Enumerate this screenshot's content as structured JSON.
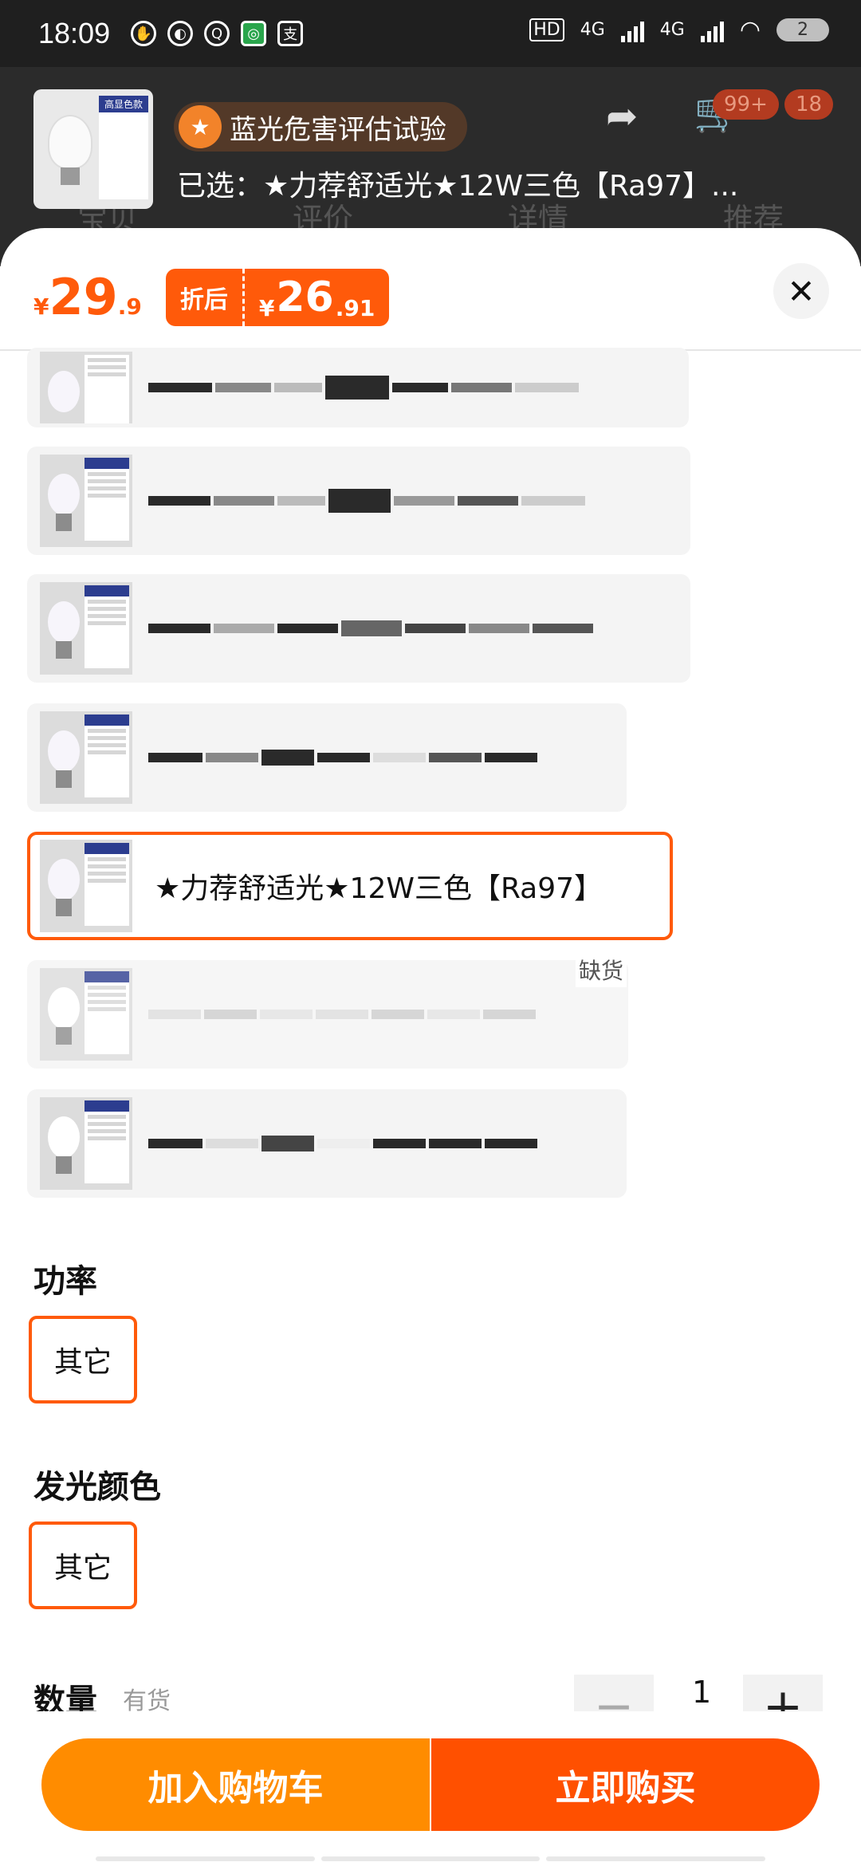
{
  "status_bar": {
    "time": "18:09",
    "hd": "HD",
    "net1": "4G",
    "net2": "4G",
    "battery": "2"
  },
  "header": {
    "thumb_panel_title": "高显色款",
    "badge_text": "蓝光危害评估试验",
    "selected_text": "已选：★力荐舒适光★12W三色【Ra97】...",
    "cart_count": "99+",
    "msg_count": "18",
    "tabs": [
      "宝贝",
      "评价",
      "详情",
      "推荐"
    ]
  },
  "price": {
    "currency": "¥",
    "original_int": "29",
    "original_dec": ".9",
    "discount_label": "折后",
    "discount_int": "26",
    "discount_dec": ".91"
  },
  "options": {
    "selected_label": "★力荐舒适光★12W三色【Ra97】",
    "out_of_stock": "缺货"
  },
  "sections": {
    "power_title": "功率",
    "power_value": "其它",
    "color_title": "发光颜色",
    "color_value": "其它",
    "qty_title": "数量",
    "stock_text": "有货",
    "qty_value": "1"
  },
  "actions": {
    "add_cart": "加入购物车",
    "buy_now": "立即购买"
  }
}
